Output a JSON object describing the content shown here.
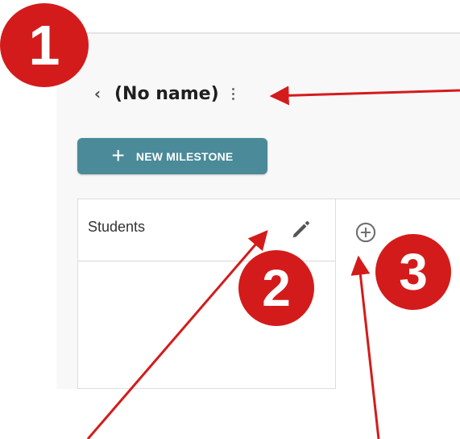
{
  "header": {
    "back_icon": "chevron-left",
    "title": "(No name)",
    "more_icon": "more-vertical"
  },
  "toolbar": {
    "new_milestone_label": "NEW MILESTONE",
    "new_milestone_icon": "plus-icon"
  },
  "board": {
    "column_title": "Students",
    "edit_icon": "pencil-icon",
    "add_column_icon": "plus-circle-icon"
  },
  "annotations": {
    "callout_1": "1",
    "callout_2": "2",
    "callout_3": "3"
  },
  "colors": {
    "accent": "#4a8a99",
    "annotation_red": "#d41b1b"
  }
}
